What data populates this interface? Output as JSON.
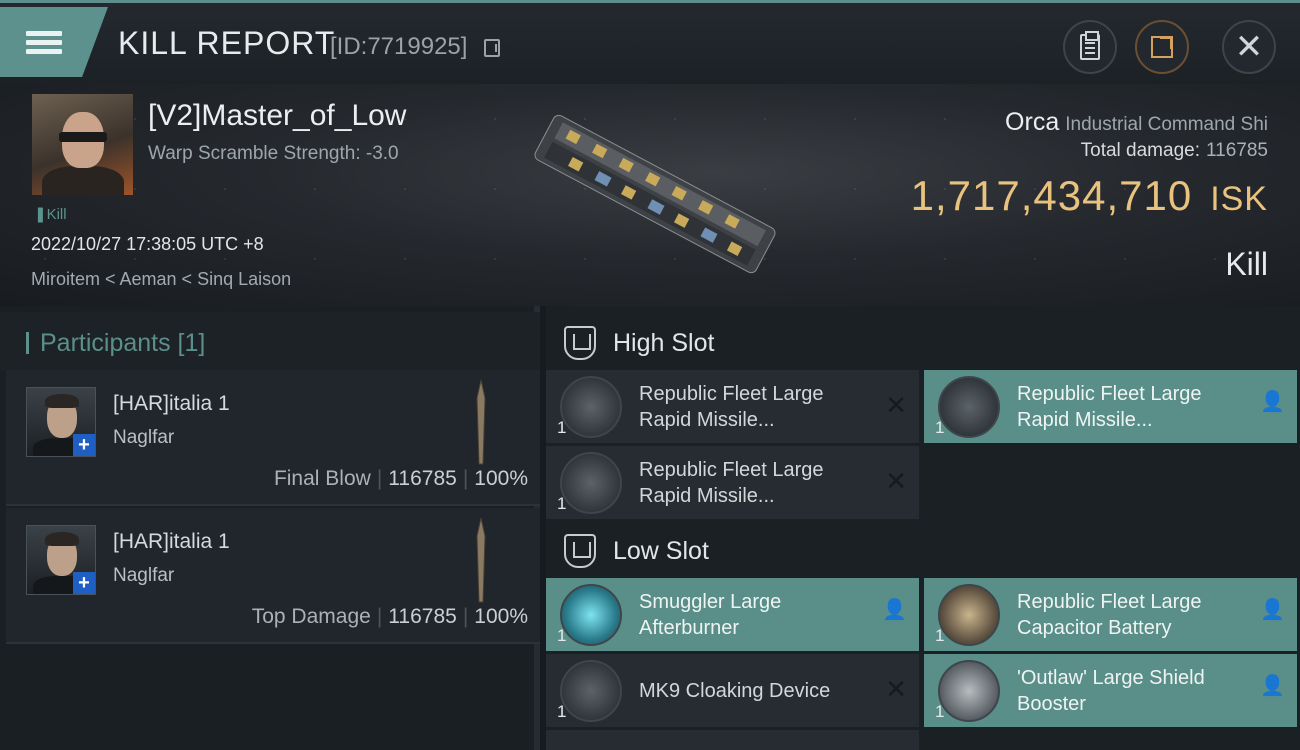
{
  "header": {
    "title": "KILL REPORT",
    "id_text": "[ID:7719925]"
  },
  "victim": {
    "name": "[V2]Master_of_Low",
    "warp": "Warp Scramble Strength: -3.0",
    "tag": "Kill",
    "datetime": "2022/10/27 17:38:05 UTC +8",
    "location": "Miroitem < Aeman < Sinq Laison"
  },
  "ship": {
    "name": "Orca",
    "class": "Industrial Command Shi",
    "total_damage_label": "Total damage:",
    "total_damage": "116785",
    "isk_value": "1,717,434,710",
    "isk_unit": "ISK",
    "result": "Kill"
  },
  "participants": {
    "heading": "Participants [1]",
    "rows": [
      {
        "name": "[HAR]italia 1",
        "ship": "Naglfar",
        "label": "Final Blow",
        "damage": "116785",
        "percent": "100%"
      },
      {
        "name": "[HAR]italia 1",
        "ship": "Naglfar",
        "label": "Top Damage",
        "damage": "116785",
        "percent": "100%"
      }
    ]
  },
  "high_slot": {
    "title": "High Slot",
    "modules": [
      {
        "line1": "Republic Fleet Large",
        "line2": "Rapid Missile...",
        "qty": "1",
        "status": "destroyed"
      },
      {
        "line1": "Republic Fleet Large",
        "line2": "Rapid Missile...",
        "qty": "1",
        "status": "dropped"
      },
      {
        "line1": "Republic Fleet Large",
        "line2": "Rapid Missile...",
        "qty": "1",
        "status": "destroyed"
      }
    ]
  },
  "low_slot": {
    "title": "Low Slot",
    "modules": [
      {
        "line1": "Smuggler Large",
        "line2": "Afterburner",
        "qty": "1",
        "status": "dropped"
      },
      {
        "line1": "Republic Fleet Large",
        "line2": "Capacitor Battery",
        "qty": "1",
        "status": "dropped"
      },
      {
        "line1": "MK9 Cloaking Device",
        "line2": "",
        "qty": "1",
        "status": "destroyed"
      },
      {
        "line1": "'Outlaw' Large Shield",
        "line2": "Booster",
        "qty": "1",
        "status": "dropped"
      }
    ]
  },
  "colors": {
    "accent_teal": "#5d918d",
    "isk_gold": "#e9c37e"
  }
}
